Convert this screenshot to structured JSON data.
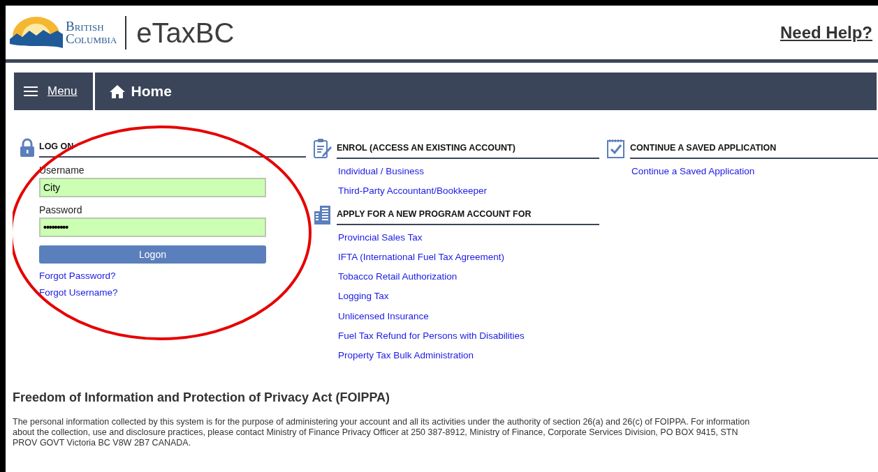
{
  "header": {
    "logo_lines": [
      "British",
      "Columbia"
    ],
    "app_title": "eTaxBC",
    "help": "Need Help?"
  },
  "navbar": {
    "menu": "Menu",
    "current": "Home"
  },
  "login": {
    "title": "LOG ON",
    "fields": [
      {
        "label": "Username",
        "value": "City",
        "kind": "text"
      },
      {
        "label": "Password",
        "value": "•••••••••",
        "kind": "password"
      }
    ],
    "button": "Logon",
    "links": [
      "Forgot Password?",
      "Forgot Username?"
    ]
  },
  "sections": [
    {
      "kind": "enrol",
      "title": "ENROL (ACCESS AN EXISTING ACCOUNT)",
      "links": [
        "Individual / Business",
        "Third-Party Accountant/Bookkeeper"
      ]
    },
    {
      "kind": "apply",
      "title": "APPLY FOR A NEW PROGRAM ACCOUNT FOR",
      "links": [
        "Provincial Sales Tax",
        "IFTA (International Fuel Tax Agreement)",
        "Tobacco Retail Authorization",
        "Logging Tax",
        "Unlicensed Insurance",
        "Fuel Tax Refund for Persons with Disabilities",
        "Property Tax Bulk Administration"
      ]
    },
    {
      "kind": "saved",
      "title": "CONTINUE A SAVED APPLICATION",
      "links": [
        "Continue a Saved Application"
      ]
    }
  ],
  "privacy": {
    "title": "Freedom of Information and Protection of Privacy Act (FOIPPA)",
    "text": "The personal information collected by this system is for the purpose of administering your account and all its activities under the authority of section 26(a) and 26(c) of FOIPPA. For information about the collection, use and disclosure practices, please contact Ministry of Finance Privacy Officer at 250 387-8912, Ministry of Finance, Corporate Services Division, PO BOX 9415, STN PROV GOVT Victoria BC V8W 2B7 CANADA."
  },
  "annotation": {
    "kind": "ellipse",
    "color": "#e60000"
  }
}
